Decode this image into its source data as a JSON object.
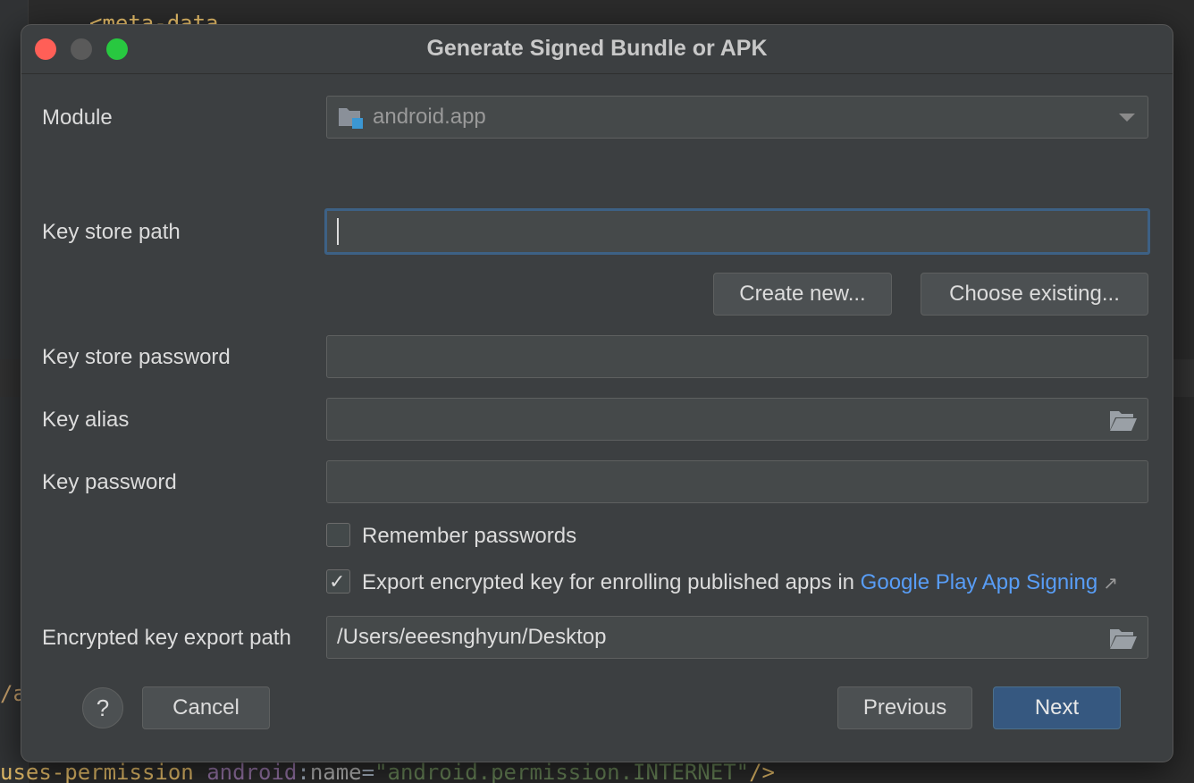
{
  "editor": {
    "top_code": "<meta-data",
    "left_fragment": "/a",
    "bottom_code": {
      "tag": "uses-permission",
      "ns": "android",
      "colon": ":",
      "attr": "name",
      "eq": "=",
      "value": "\"android.permission.INTERNET\"",
      "close": "/>"
    }
  },
  "dialog": {
    "title": "Generate Signed Bundle or APK",
    "module": {
      "label": "Module",
      "value": "android.app",
      "icon": "module-folder-icon"
    },
    "key_store_path": {
      "label": "Key store path",
      "value": ""
    },
    "buttons": {
      "create_new": "Create new...",
      "choose_existing": "Choose existing..."
    },
    "key_store_password": {
      "label": "Key store password",
      "value": ""
    },
    "key_alias": {
      "label": "Key alias",
      "value": "",
      "icon": "folder-open-icon"
    },
    "key_password": {
      "label": "Key password",
      "value": ""
    },
    "remember_passwords": {
      "label": "Remember passwords",
      "checked": false
    },
    "export_encrypted": {
      "label": "Export encrypted key for enrolling published apps in ",
      "link": "Google Play App Signing",
      "link_icon": "↗",
      "checked": true
    },
    "encrypted_key_export_path": {
      "label": "Encrypted key export path",
      "value": "/Users/eeesnghyun/Desktop",
      "icon": "folder-open-icon"
    },
    "footer": {
      "help": "?",
      "cancel": "Cancel",
      "previous": "Previous",
      "next": "Next"
    }
  },
  "colors": {
    "dialog_bg": "#3c3f41",
    "field_bg": "#45494a",
    "focus_border": "#3d6185",
    "primary_button": "#365880",
    "link": "#589df6",
    "traffic_close": "#ff5f57",
    "traffic_min": "#5a5a5a",
    "traffic_max": "#28c840"
  }
}
